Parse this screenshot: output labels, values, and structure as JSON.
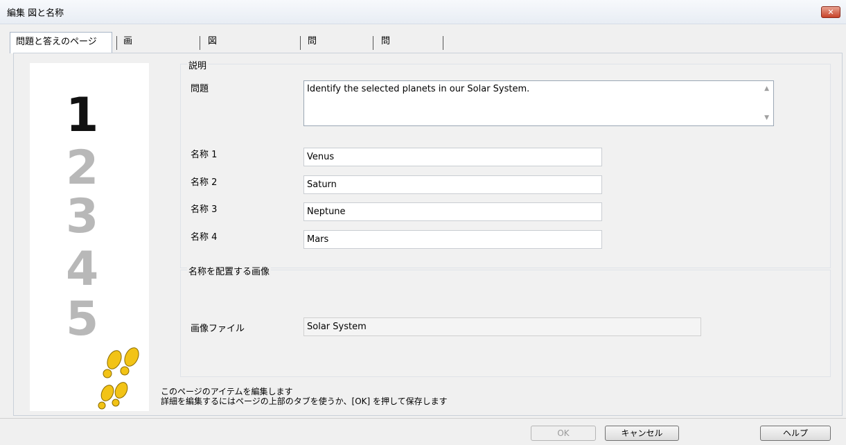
{
  "window": {
    "title": "編集 図と名称",
    "close_glyph": "✕"
  },
  "tabs": [
    {
      "label": "問題と答えのページ"
    },
    {
      "label": "画像を調整する"
    },
    {
      "label": "図に名称を配置する"
    },
    {
      "label": "問題の素材"
    },
    {
      "label": "問題の詳細"
    }
  ],
  "sidebar": {
    "numbers": [
      "1",
      "2",
      "3",
      "4",
      "5"
    ]
  },
  "description": {
    "group_label": "説明",
    "question_label": "問題",
    "question_value": "Identify the selected planets in our Solar System."
  },
  "names": [
    {
      "label": "名称 1",
      "value": "Venus"
    },
    {
      "label": "名称 2",
      "value": "Saturn"
    },
    {
      "label": "名称 3",
      "value": "Neptune"
    },
    {
      "label": "名称 4",
      "value": "Mars"
    }
  ],
  "image_group": {
    "group_label": "名称を配置する画像",
    "file_label": "画像ファイル",
    "file_value": "Solar System"
  },
  "hint": {
    "line1": "このページのアイテムを編集します",
    "line2": "詳細を編集するにはページの上部のタブを使うか、[OK] を押して保存します"
  },
  "buttons": {
    "ok": "OK",
    "cancel": "キャンセル",
    "help": "ヘルプ"
  },
  "colors": {
    "footprint": "#f2c316",
    "active_number": "#111111",
    "inactive_number": "#b8b8b8"
  }
}
